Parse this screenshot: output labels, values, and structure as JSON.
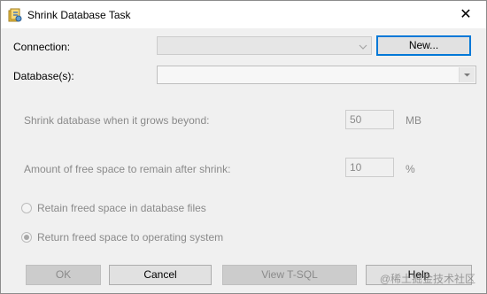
{
  "window": {
    "title": "Shrink Database Task",
    "close_glyph": "✕"
  },
  "connection": {
    "label": "Connection:",
    "value": "",
    "new_button": "New..."
  },
  "database": {
    "label": "Database(s):",
    "value": ""
  },
  "shrink": {
    "grows_label": "Shrink database when it grows beyond:",
    "grows_value": "50",
    "grows_unit": "MB",
    "free_label": "Amount of free space to remain after shrink:",
    "free_value": "10",
    "free_unit": "%"
  },
  "options": {
    "retain_label": "Retain freed space in database files",
    "return_label": "Return freed space to operating system",
    "selected": "return"
  },
  "buttons": {
    "ok": "OK",
    "cancel": "Cancel",
    "view_tsql": "View T-SQL",
    "help": "Help"
  },
  "watermark": "@稀土掘金技术社区",
  "icons": {
    "title": "database-task-icon",
    "close": "close-icon",
    "dropdown": "chevron-down-icon"
  }
}
